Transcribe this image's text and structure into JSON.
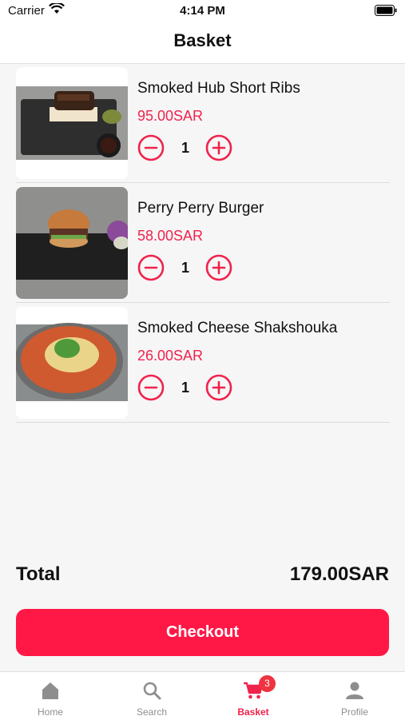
{
  "status_bar": {
    "carrier": "Carrier",
    "time": "4:14 PM"
  },
  "header": {
    "title": "Basket"
  },
  "items": [
    {
      "name": "Smoked Hub Short Ribs",
      "price": "95.00SAR",
      "quantity": "1"
    },
    {
      "name": "Perry Perry Burger",
      "price": "58.00SAR",
      "quantity": "1"
    },
    {
      "name": "Smoked Cheese Shakshouka",
      "price": "26.00SAR",
      "quantity": "1"
    }
  ],
  "total": {
    "label": "Total",
    "value": "179.00SAR"
  },
  "checkout": {
    "label": "Checkout"
  },
  "tabs": [
    {
      "label": "Home",
      "icon": "home-icon"
    },
    {
      "label": "Search",
      "icon": "search-icon"
    },
    {
      "label": "Basket",
      "icon": "cart-icon",
      "badge": "3",
      "active": true
    },
    {
      "label": "Profile",
      "icon": "person-icon"
    }
  ],
  "colors": {
    "accent": "#ff1846",
    "price": "#f0234d",
    "badge": "#ef3340"
  }
}
